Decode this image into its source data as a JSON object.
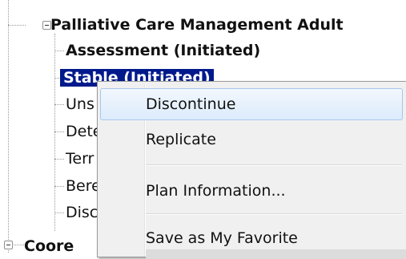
{
  "tree": {
    "parent": {
      "label": "Palliative Care Management Adult"
    },
    "children": [
      {
        "label": "Assessment (Initiated)"
      },
      {
        "label": "Stable (Initiated)"
      },
      {
        "label": "Uns"
      },
      {
        "label": "Dete"
      },
      {
        "label": "Terr"
      },
      {
        "label": "Bere"
      },
      {
        "label": "Disc"
      }
    ],
    "next_parent": {
      "label": "Coore"
    }
  },
  "context_menu": {
    "items": [
      {
        "label": "Discontinue"
      },
      {
        "label": "Replicate"
      },
      {
        "label": "Plan Information..."
      },
      {
        "label": "Save as My Favorite"
      }
    ]
  }
}
